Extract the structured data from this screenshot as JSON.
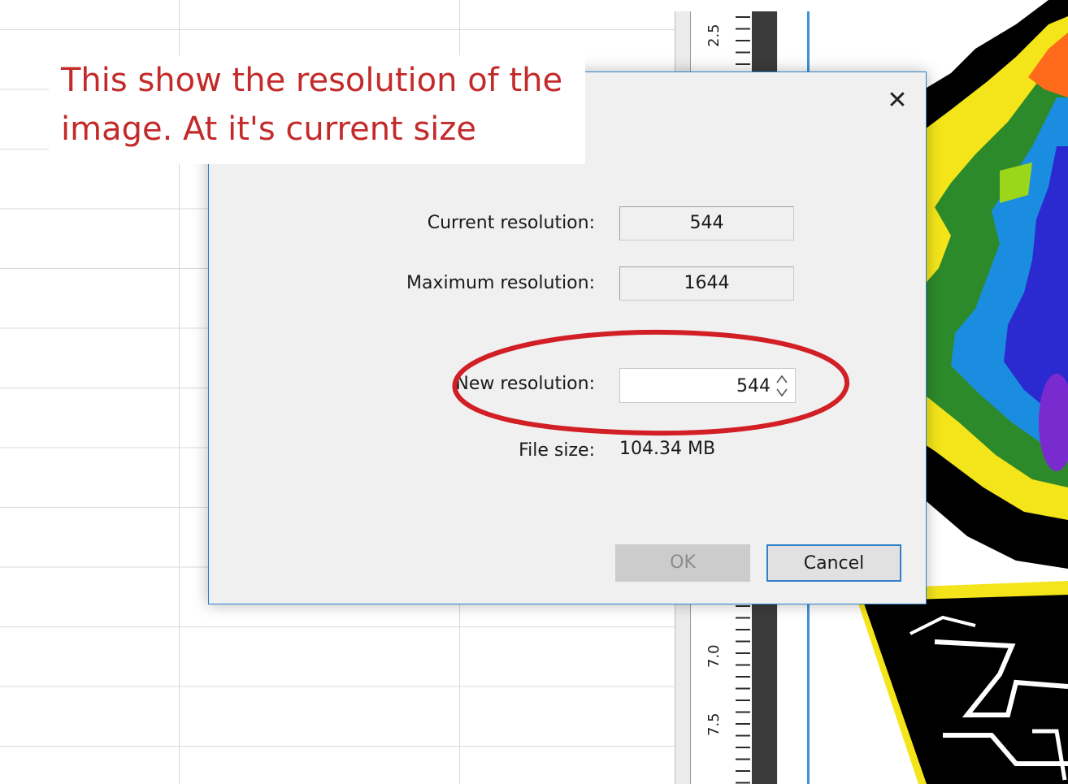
{
  "ruler": {
    "labels": [
      "2.5",
      "7.0",
      "7.5"
    ]
  },
  "annotation": {
    "line1": "This show the resolution of the",
    "line2": "image. At it's current size"
  },
  "dialog": {
    "close_label": "✕",
    "current_resolution_label": "Current resolution:",
    "current_resolution_value": "544",
    "maximum_resolution_label": "Maximum resolution:",
    "maximum_resolution_value": "1644",
    "new_resolution_label": "New resolution:",
    "new_resolution_value": "544",
    "file_size_label": "File size:",
    "file_size_value": "104.34 MB",
    "ok_label": "OK",
    "cancel_label": "Cancel"
  },
  "colors": {
    "annotation_red": "#c32a2a",
    "accent_blue": "#2f7fc9",
    "disabled_gray": "#cccccc"
  },
  "icons": [
    "close-icon",
    "spin-up-icon",
    "spin-down-icon"
  ]
}
